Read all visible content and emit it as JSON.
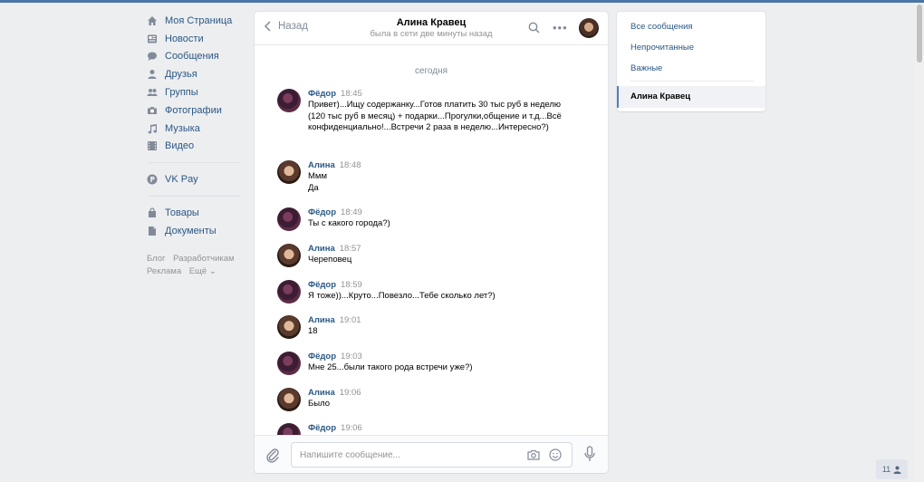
{
  "nav": {
    "items": [
      {
        "label": "Моя Страница",
        "icon": "home-icon"
      },
      {
        "label": "Новости",
        "icon": "news-icon"
      },
      {
        "label": "Сообщения",
        "icon": "messages-icon"
      },
      {
        "label": "Друзья",
        "icon": "friends-icon"
      },
      {
        "label": "Группы",
        "icon": "groups-icon"
      },
      {
        "label": "Фотографии",
        "icon": "camera-icon"
      },
      {
        "label": "Музыка",
        "icon": "music-icon"
      },
      {
        "label": "Видео",
        "icon": "video-icon"
      }
    ],
    "pay": {
      "label": "VK Pay",
      "icon": "vkpay-icon"
    },
    "more_items": [
      {
        "label": "Товары",
        "icon": "goods-icon"
      },
      {
        "label": "Документы",
        "icon": "documents-icon"
      }
    ],
    "footer": {
      "blog": "Блог",
      "dev": "Разработчикам",
      "ads": "Реклама",
      "more": "Ещё ⌄"
    }
  },
  "chat": {
    "back_label": "Назад",
    "contact_name": "Алина Кравец",
    "contact_status": "была в сети две минуты назад",
    "date_separator": "сегодня",
    "messages": [
      {
        "author": "Фёдор",
        "time": "18:45",
        "text": "Привет)...Ищу содержанку...Готов платить 30 тыс руб в неделю (120 тыс руб в месяц) + подарки...Прогулки,общение и т.д...Всё конфиденциально!...Встречи 2 раза в неделю...Интересно?)"
      },
      {
        "author": "Алина",
        "time": "18:48",
        "text": "Ммм\nДа"
      },
      {
        "author": "Фёдор",
        "time": "18:49",
        "text": "Ты с какого города?)"
      },
      {
        "author": "Алина",
        "time": "18:57",
        "text": "Череповец"
      },
      {
        "author": "Фёдор",
        "time": "18:59",
        "text": "Я тоже))...Круто...Повезло...Тебе сколько лет?)"
      },
      {
        "author": "Алина",
        "time": "19:01",
        "text": "18"
      },
      {
        "author": "Фёдор",
        "time": "19:03",
        "text": "Мне 25...были такого рода встречи уже?)"
      },
      {
        "author": "Алина",
        "time": "19:06",
        "text": "Было"
      },
      {
        "author": "Фёдор",
        "time": "19:06",
        "text": ""
      }
    ],
    "input_placeholder": "Напишите сообщение..."
  },
  "right_panel": {
    "all": "Все сообщения",
    "unread": "Непрочитанные",
    "important": "Важные",
    "active_dialog": "Алина Кравец"
  },
  "online_count": "11"
}
